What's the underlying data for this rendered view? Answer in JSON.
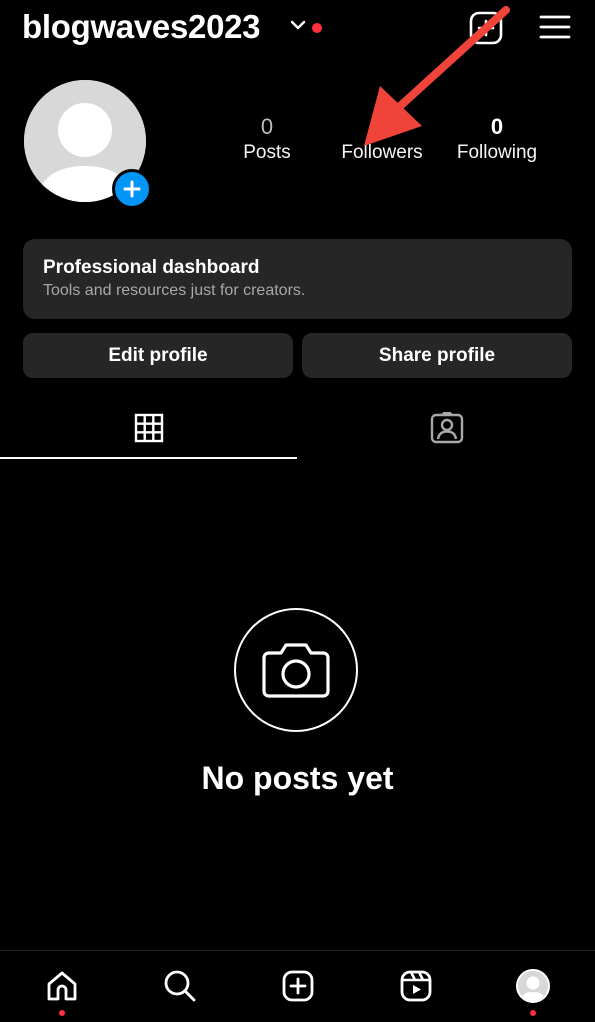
{
  "header": {
    "username": "blogwaves2023",
    "accent_color": "#ff3040"
  },
  "profile": {
    "avatar_icon": "default-avatar-icon",
    "add_story_icon": "plus-icon"
  },
  "stats": {
    "posts": {
      "count": "0",
      "label": "Posts"
    },
    "followers": {
      "count": "",
      "label": "Followers"
    },
    "following": {
      "count": "0",
      "label": "Following"
    }
  },
  "dashboard": {
    "title": "Professional dashboard",
    "subtitle": "Tools and resources just for creators."
  },
  "actions": {
    "edit_label": "Edit profile",
    "share_label": "Share profile"
  },
  "tabs": [
    {
      "icon": "grid-icon",
      "active": true
    },
    {
      "icon": "tagged-icon",
      "active": false
    }
  ],
  "empty_state": {
    "icon": "camera-icon",
    "message": "No posts yet"
  },
  "annotation": {
    "icon": "red-arrow-icon",
    "color": "#f0443a"
  },
  "bottom_nav": [
    {
      "icon": "home-icon",
      "notification_dot": true
    },
    {
      "icon": "search-icon",
      "notification_dot": false
    },
    {
      "icon": "create-icon",
      "notification_dot": false
    },
    {
      "icon": "reels-icon",
      "notification_dot": false
    },
    {
      "icon": "profile-avatar-icon",
      "notification_dot": true
    }
  ]
}
